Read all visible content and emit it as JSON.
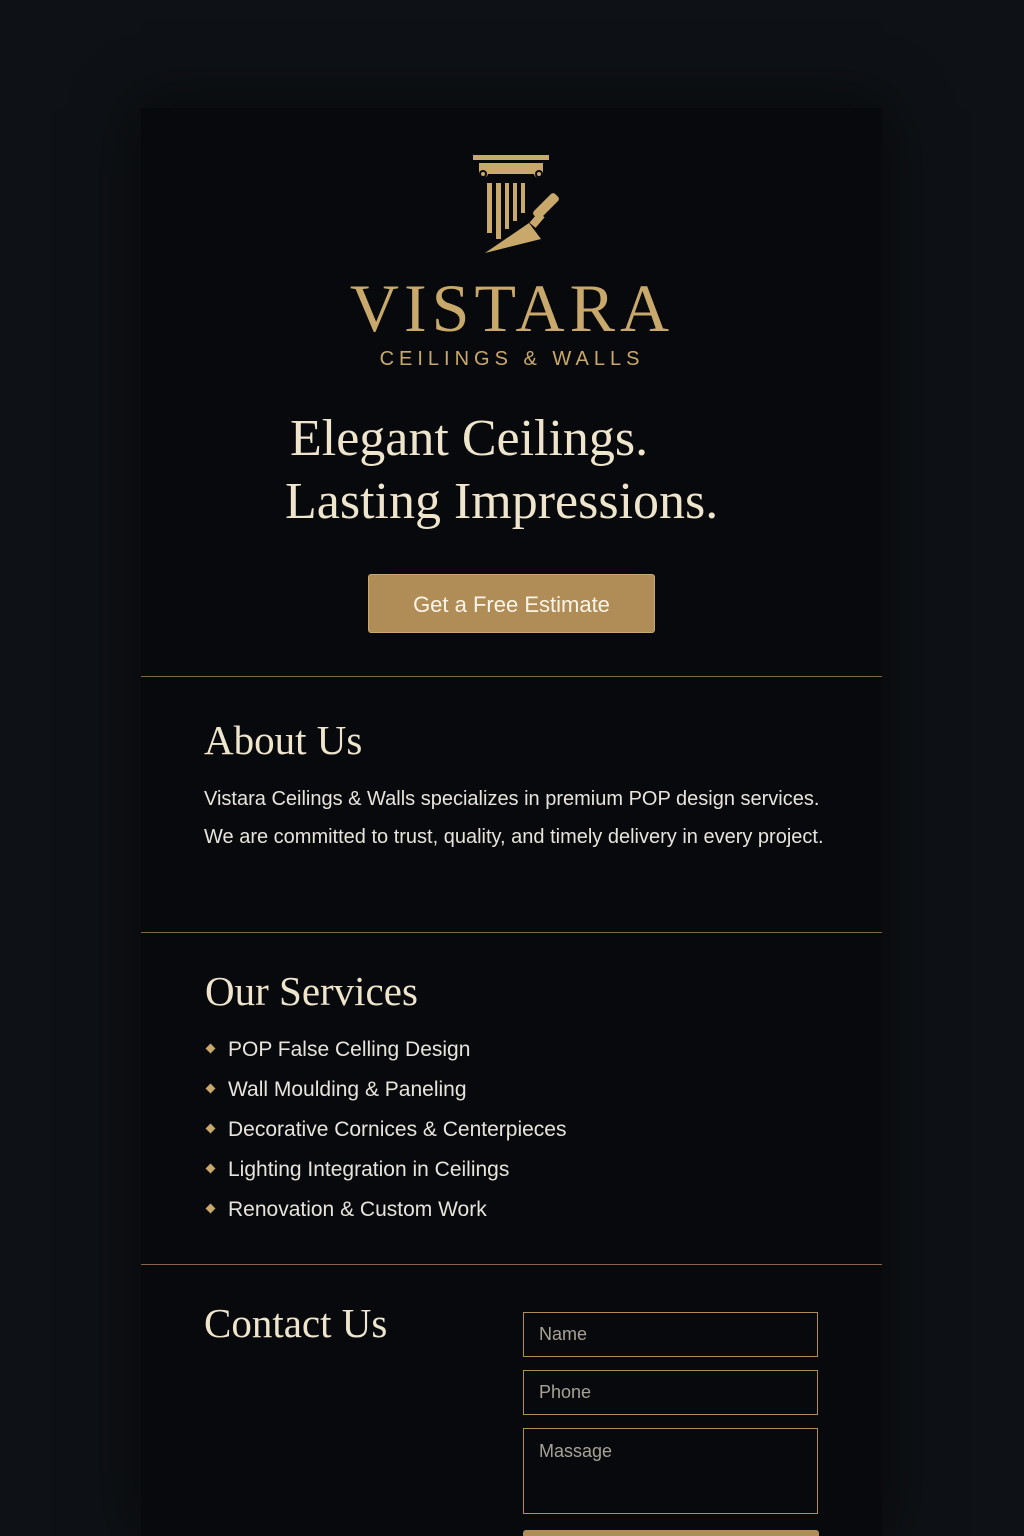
{
  "brand": {
    "name": "VISTARA",
    "tagline": "CEILINGS & WALLS",
    "logo_icon": "column-trowel-icon"
  },
  "hero": {
    "line1": "Elegant Ceilings.",
    "line2": "Lasting Impressions.",
    "cta_label": "Get a Free Estimate"
  },
  "about": {
    "title": "About Us",
    "body": "Vistara Ceilings & Walls specializes in premium POP design services. We are committed to trust, quality, and timely delivery in every project."
  },
  "services": {
    "title": "Our Services",
    "items": [
      "POP False Celling Design",
      "Wall Moulding & Paneling",
      "Decorative Cornices & Centerpieces",
      "Lighting Integration in Ceilings",
      "Renovation & Custom Work"
    ]
  },
  "contact": {
    "title": "Contact Us",
    "name_placeholder": "Name",
    "phone_placeholder": "Phone",
    "message_placeholder": "Massage"
  },
  "colors": {
    "page_background": "#0e1115",
    "card_background": "#07090c",
    "accent_gold": "#b08d57",
    "light_gold": "#c9a96b",
    "heading_cream": "#efe4cc"
  }
}
